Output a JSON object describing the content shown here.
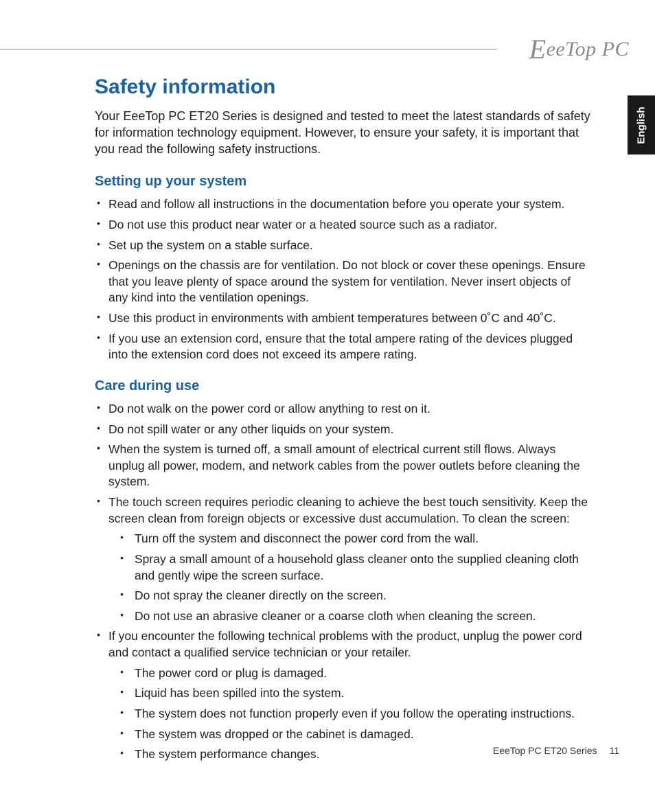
{
  "brand": {
    "text": "eeTop PC"
  },
  "languageTab": "English",
  "title": "Safety information",
  "intro": "Your EeeTop PC ET20 Series is designed and tested to meet the latest standards of safety for information technology equipment. However, to ensure your safety, it is important that you read the following safety instructions.",
  "sections": [
    {
      "heading": "Setting up your system",
      "items": [
        {
          "text": "Read and follow all instructions in the documentation before you operate your system."
        },
        {
          "text": "Do not use this product near water or a heated source such as a radiator."
        },
        {
          "text": "Set up the system on a stable surface."
        },
        {
          "text": "Openings on the chassis are for ventilation. Do not block or cover these openings. Ensure that you leave plenty of space around the system for ventilation. Never insert objects of any kind into the ventilation openings."
        },
        {
          "text": "Use this product in environments with ambient temperatures between 0˚C and 40˚C."
        },
        {
          "text": "If you use an extension cord, ensure that the total ampere rating of the devices plugged into the extension cord does not exceed its ampere rating."
        }
      ]
    },
    {
      "heading": "Care during use",
      "items": [
        {
          "text": "Do not walk on the power cord or allow anything to rest on it."
        },
        {
          "text": "Do not spill water or any other liquids on your system."
        },
        {
          "text": "When the system is turned off, a small amount of electrical current still flows. Always unplug all power, modem, and network cables from the power outlets before cleaning the system."
        },
        {
          "text": "The touch screen requires periodic cleaning to achieve the best touch sensitivity. Keep the screen clean from foreign objects or excessive dust accumulation. To clean the screen:",
          "sub": [
            "Turn off the system and disconnect the power cord from the wall.",
            "Spray a small amount of a household glass cleaner onto the supplied cleaning cloth and gently wipe the screen surface.",
            "Do not spray the cleaner directly on the screen.",
            "Do not use an abrasive cleaner or a coarse cloth when cleaning the screen."
          ]
        },
        {
          "text": "If you encounter the following technical problems with the product, unplug the power cord and contact a qualified service technician or your retailer.",
          "sub": [
            "The power cord or plug is damaged.",
            "Liquid has been spilled into the system.",
            "The system does not function properly even if you follow the operating instructions.",
            "The system was dropped or the cabinet is damaged.",
            "The system performance changes."
          ]
        }
      ]
    }
  ],
  "footer": {
    "series": "EeeTop PC ET20 Series",
    "page": "11"
  }
}
